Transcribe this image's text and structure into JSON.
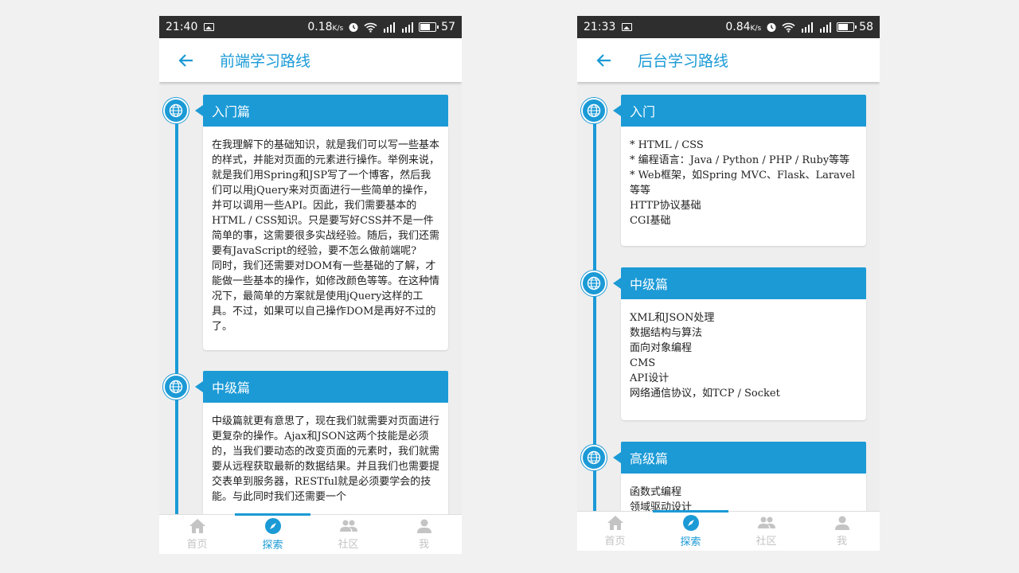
{
  "colors": {
    "accent": "#1b9ad6",
    "statusbar": "#2e2e2e",
    "inactive": "#c4c4c4"
  },
  "left": {
    "status": {
      "time": "21:40",
      "speed": "0.18",
      "speed_unit": "K/s",
      "battery": "57",
      "battery_level": 0.57
    },
    "title": "前端学习路线",
    "sections": [
      {
        "title": "入门篇",
        "body": "在我理解下的基础知识，就是我们可以写一些基本的样式，并能对页面的元素进行操作。举例来说，就是我们用Spring和JSP写了一个博客，然后我们可以用jQuery来对页面进行一些简单的操作，并可以调用一些API。因此，我们需要基本的HTML / CSS知识。只是要写好CSS并不是一件简单的事，这需要很多实战经验。随后，我们还需要有JavaScript的经验，要不怎么做前端呢?\n同时，我们还需要对DOM有一些基础的了解，才能做一些基本的操作，如修改颜色等等。在这种情况下，最简单的方案就是使用jQuery这样的工具。不过，如果可以自己操作DOM是再好不过的了。"
      },
      {
        "title": "中级篇",
        "body": "中级篇就更有意思了，现在我们就需要对页面进行更复杂的操作。Ajax和JSON这两个技能是必须的，当我们要动态的改变页面的元素时，我们就需要从远程获取最新的数据结果。并且我们也需要提交表单到服务器，RESTful就是必须要学会的技能。与此同时我们还需要一个"
      }
    ],
    "nav": [
      {
        "label": "首页",
        "icon": "home-icon"
      },
      {
        "label": "探索",
        "icon": "compass-icon"
      },
      {
        "label": "社区",
        "icon": "group-icon"
      },
      {
        "label": "我",
        "icon": "person-icon"
      }
    ]
  },
  "right": {
    "status": {
      "time": "21:33",
      "speed": "0.84",
      "speed_unit": "K/s",
      "battery": "58",
      "battery_level": 0.58
    },
    "title": "后台学习路线",
    "sections": [
      {
        "title": "入门",
        "body": "* HTML / CSS\n* 编程语言：Java / Python / PHP / Ruby等等\n* Web框架，如Spring MVC、Flask、Laravel等等\nHTTP协议基础\nCGI基础"
      },
      {
        "title": "中级篇",
        "body": "XML和JSON处理\n数据结构与算法\n面向对象编程\nCMS\nAPI设计\n网络通信协议，如TCP / Socket"
      },
      {
        "title": "高级篇",
        "body": "函数式编程\n领域驱动设计"
      }
    ],
    "nav": [
      {
        "label": "首页",
        "icon": "home-icon"
      },
      {
        "label": "探索",
        "icon": "compass-icon"
      },
      {
        "label": "社区",
        "icon": "group-icon"
      },
      {
        "label": "我",
        "icon": "person-icon"
      }
    ]
  }
}
